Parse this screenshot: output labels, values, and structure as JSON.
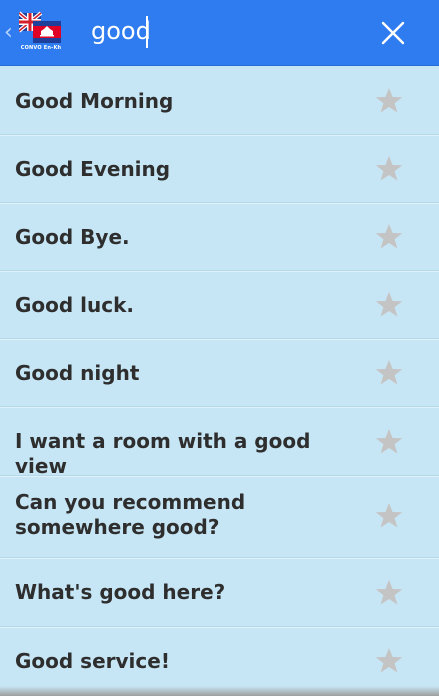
{
  "header": {
    "logo_caption": "CONVO En-Kh",
    "search": {
      "value": "good"
    },
    "icons": {
      "back": "chevron-left-icon",
      "clear": "close-icon",
      "favorite": "star-icon"
    }
  },
  "colors": {
    "header_bg": "#2f7cf0",
    "list_bg": "#c7e6f5",
    "text": "#2e2e2e",
    "star": "#c4c4c4"
  },
  "phrases": [
    {
      "label": "Good Morning"
    },
    {
      "label": "Good Evening"
    },
    {
      "label": "Good Bye."
    },
    {
      "label": "Good luck."
    },
    {
      "label": "Good night"
    },
    {
      "label": "I want a room with a good view"
    },
    {
      "label": "Can you recommend somewhere good?"
    },
    {
      "label": "What's good here?"
    },
    {
      "label": "Good service!"
    }
  ]
}
